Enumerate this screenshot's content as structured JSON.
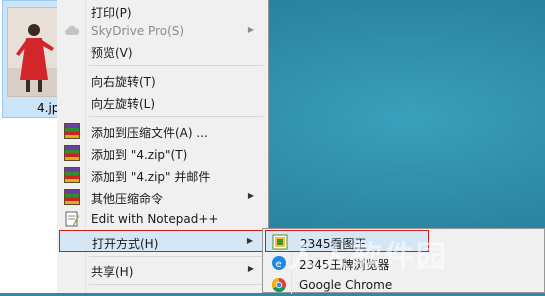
{
  "explorer": {
    "file_name": "4.jp"
  },
  "context_menu": {
    "items": [
      {
        "label": "打印(P)",
        "icon": "none"
      },
      {
        "label": "SkyDrive Pro(S)",
        "icon": "cloud-icon",
        "disabled": true,
        "submenu": true
      },
      {
        "label": "预览(V)",
        "icon": "none"
      },
      {
        "label": "向右旋转(T)",
        "icon": "none"
      },
      {
        "label": "向左旋转(L)",
        "icon": "none"
      },
      {
        "label": "添加到压缩文件(A) ...",
        "icon": "winrar-icon"
      },
      {
        "label": "添加到 \"4.zip\"(T)",
        "icon": "winrar-icon"
      },
      {
        "label": "添加到 \"4.zip\" 并邮件",
        "icon": "winrar-icon"
      },
      {
        "label": "其他压缩命令",
        "icon": "winrar-icon",
        "submenu": true
      },
      {
        "label": "Edit with Notepad++",
        "icon": "notepad-plus-plus-icon"
      },
      {
        "label": "打开方式(H)",
        "icon": "none",
        "submenu": true,
        "highlighted": true
      },
      {
        "label": "共享(H)",
        "icon": "none",
        "submenu": true
      }
    ],
    "arrow_glyph": "▶"
  },
  "open_with_submenu": {
    "items": [
      {
        "label": "2345看图王",
        "icon": "2345-viewer-icon",
        "highlighted": true
      },
      {
        "label": "2345王牌浏览器",
        "icon": "2345-browser-icon"
      },
      {
        "label": "Google Chrome",
        "icon": "chrome-icon"
      }
    ]
  },
  "watermark": {
    "text": "人人软件园"
  }
}
